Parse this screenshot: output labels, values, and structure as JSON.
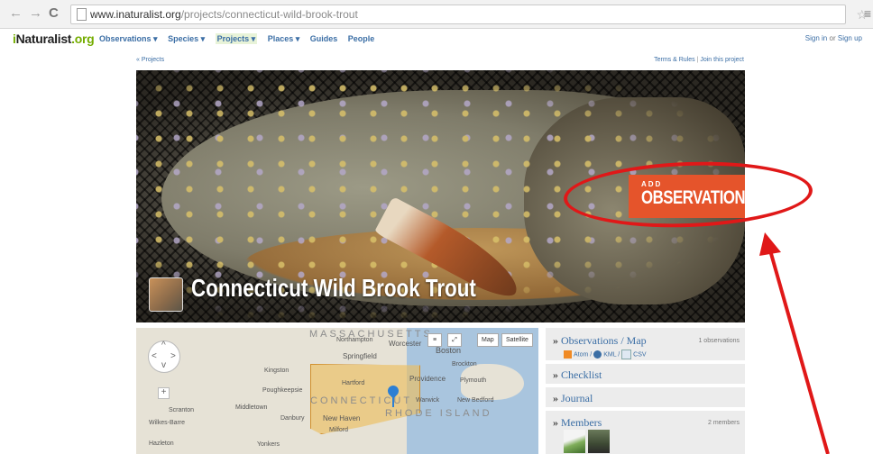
{
  "browser": {
    "url_host": "www.inaturalist.org",
    "url_path": "/projects/connecticut-wild-brook-trout"
  },
  "nav": {
    "logo_prefix": "i",
    "logo_main": "Naturalist",
    "logo_suffix": ".org",
    "items": [
      "Observations ▾",
      "Species ▾",
      "Projects ▾",
      "Places ▾",
      "Guides",
      "People"
    ],
    "sign_in": "Sign in",
    "sign_or": "or",
    "sign_up": "Sign up"
  },
  "breadcrumb": "« Projects",
  "terms": {
    "terms_label": "Terms & Rules",
    "separator": "|",
    "join_label": "Join this project"
  },
  "banner": {
    "add_small": "ADD",
    "add_big": "OBSERVATIONS",
    "project_title": "Connecticut Wild Brook Trout"
  },
  "map": {
    "map_button": "Map",
    "satellite_button": "Satellite",
    "labels": {
      "massachusetts": "MASSACHUSETTS",
      "connecticut": "CONNECTICUT",
      "rhode_island": "RHODE ISLAND",
      "northampton": "Northampton",
      "worcester": "Worcester",
      "boston": "Boston",
      "springfield": "Springfield",
      "brockton": "Brockton",
      "kingston": "Kingston",
      "hartford": "Hartford",
      "providence": "Providence",
      "plymouth": "Plymouth",
      "poughkeepsie": "Poughkeepsie",
      "warwick": "Warwick",
      "new_bedford": "New Bedford",
      "middletown": "Middletown",
      "scranton": "Scranton",
      "danbury": "Danbury",
      "new_haven": "New Haven",
      "wilkes_barre": "Wilkes-Barre",
      "milford": "Milford",
      "hazleton": "Hazleton",
      "yonkers": "Yonkers"
    }
  },
  "sidebar": {
    "observations": {
      "title": "Observations / Map",
      "count": "1 observations",
      "atom": "Atom",
      "kml": "KML",
      "csv": "CSV"
    },
    "checklist": {
      "title": "Checklist"
    },
    "journal": {
      "title": "Journal"
    },
    "members": {
      "title": "Members",
      "count": "2 members"
    }
  },
  "colors": {
    "accent": "#e5542b",
    "annotation": "#e01818",
    "link": "#3b6ea5",
    "logo_green": "#74ac00"
  }
}
